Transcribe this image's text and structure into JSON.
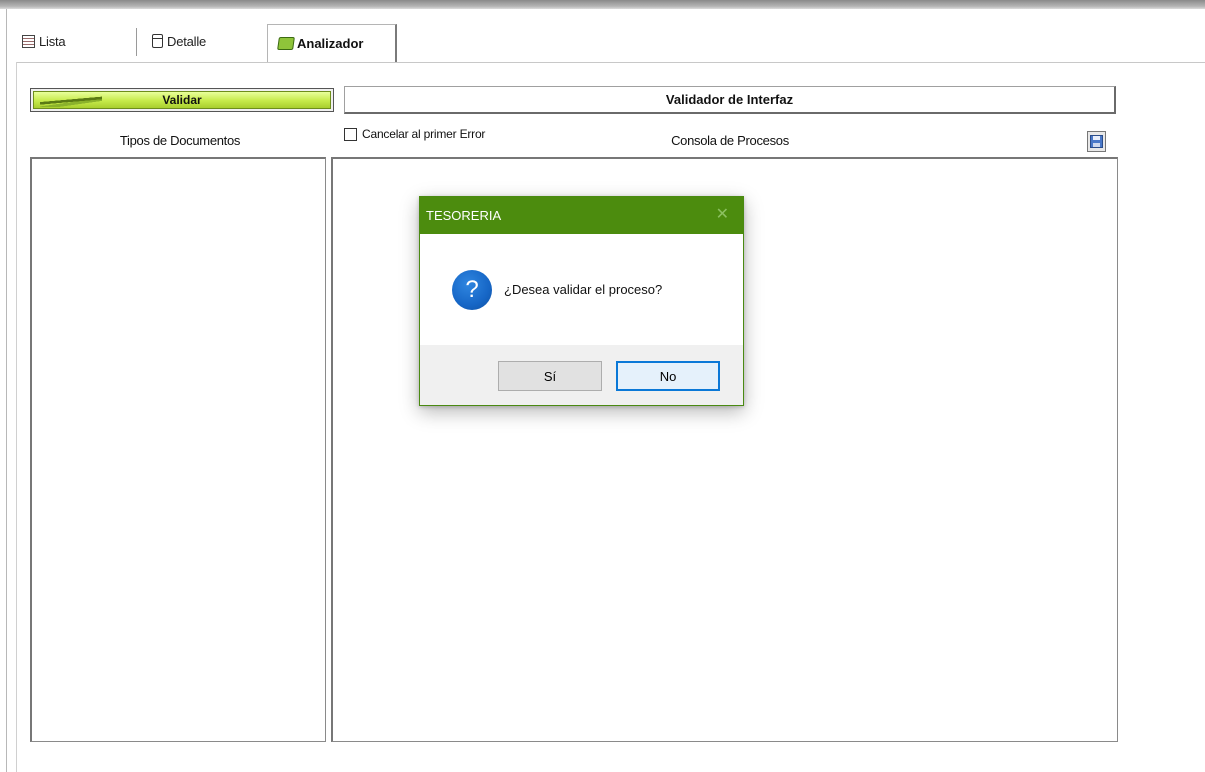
{
  "tabs": [
    {
      "label": "Lista",
      "icon": "list-icon"
    },
    {
      "label": "Detalle",
      "icon": "document-icon"
    },
    {
      "label": "Analizador",
      "icon": "analyzer-icon",
      "active": true
    }
  ],
  "toolbar": {
    "validar_label": "Validar",
    "header_title": "Validador de Interfaz",
    "save_icon": "save-icon"
  },
  "left_panel": {
    "title": "Tipos de Documentos",
    "items": []
  },
  "options": {
    "cancel_first_error_label": "Cancelar al primer Error",
    "cancel_first_error_checked": false
  },
  "console": {
    "title": "Consola de Procesos",
    "lines": []
  },
  "dialog": {
    "title": "TESORERIA",
    "icon": "question-icon",
    "message": "¿Desea validar el proceso?",
    "yes_label": "Sí",
    "no_label": "No",
    "close_glyph": "✕"
  },
  "colors": {
    "dialog_title_bg": "#4c8c0e",
    "validar_green": "#c6ea4a",
    "question_blue": "#1666c6",
    "default_button_border": "#0a78d7"
  }
}
